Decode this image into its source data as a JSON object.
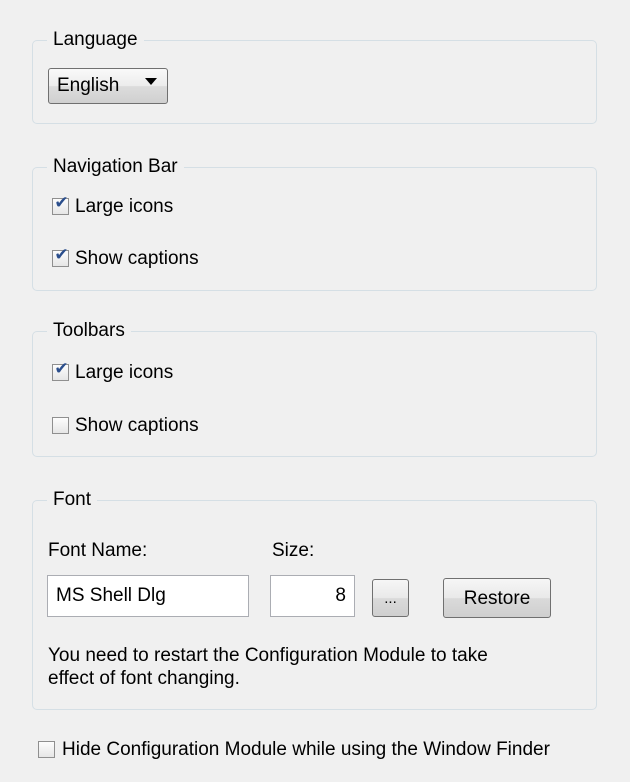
{
  "language": {
    "legend": "Language",
    "selected": "English"
  },
  "navigation_bar": {
    "legend": "Navigation Bar",
    "large_icons": {
      "label": "Large icons",
      "checked": true
    },
    "show_captions": {
      "label": "Show captions",
      "checked": true
    }
  },
  "toolbars": {
    "legend": "Toolbars",
    "large_icons": {
      "label": "Large icons",
      "checked": true
    },
    "show_captions": {
      "label": "Show captions",
      "checked": false
    }
  },
  "font": {
    "legend": "Font",
    "font_name_label": "Font Name:",
    "size_label": "Size:",
    "font_name_value": "MS Shell Dlg",
    "size_value": "8",
    "browse_label": "...",
    "restore_label": "Restore",
    "note_line1": "You need to restart the Configuration Module to take",
    "note_line2": "effect of font changing."
  },
  "hide_module": {
    "label": "Hide Configuration Module while using the Window Finder",
    "checked": false
  },
  "check_mark": "✔"
}
